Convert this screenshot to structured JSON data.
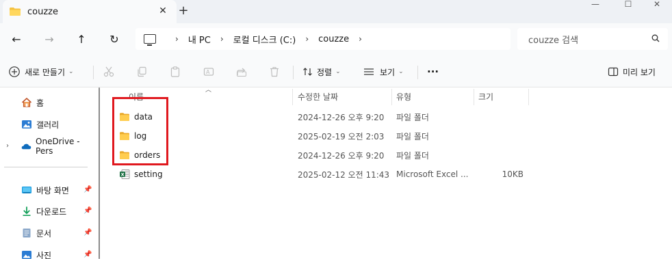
{
  "window": {
    "tab_title": "couzze",
    "tab_close": "✕",
    "new_tab": "+",
    "minimize": "—",
    "maximize": "☐",
    "close": "✕"
  },
  "nav": {
    "back": "←",
    "forward": "→",
    "up": "↑",
    "refresh": "↻"
  },
  "address": {
    "separator": "›",
    "breadcrumbs": [
      "내 PC",
      "로컬 디스크 (C:)",
      "couzze"
    ]
  },
  "search": {
    "placeholder": "couzze 검색"
  },
  "toolbar": {
    "new_label": "새로 만들기",
    "sort_label": "정렬",
    "view_label": "보기",
    "more_label": "···",
    "details_label": "미리 보기"
  },
  "sidebar": {
    "items": [
      {
        "label": "홈",
        "icon": "home-icon"
      },
      {
        "label": "갤러리",
        "icon": "gallery-icon"
      },
      {
        "label": "OneDrive - Pers",
        "icon": "onedrive-icon"
      },
      {
        "label": "바탕 화면",
        "icon": "desktop-icon"
      },
      {
        "label": "다운로드",
        "icon": "download-icon"
      },
      {
        "label": "문서",
        "icon": "documents-icon"
      },
      {
        "label": "사진",
        "icon": "pictures-icon"
      }
    ],
    "expander": "›",
    "pin": "📌"
  },
  "columns": {
    "name": "이름",
    "date": "수정한 날짜",
    "type": "유형",
    "size": "크기"
  },
  "files": [
    {
      "name": "data",
      "date": "2024-12-26 오후 9:20",
      "type": "파일 폴더",
      "size": "",
      "icon": "folder-icon"
    },
    {
      "name": "log",
      "date": "2025-02-19 오전 2:03",
      "type": "파일 폴더",
      "size": "",
      "icon": "folder-icon"
    },
    {
      "name": "orders",
      "date": "2024-12-26 오후 9:20",
      "type": "파일 폴더",
      "size": "",
      "icon": "folder-icon"
    },
    {
      "name": "setting",
      "date": "2025-02-12 오전 11:43",
      "type": "Microsoft Excel ...",
      "size": "10KB",
      "icon": "excel-icon"
    }
  ],
  "colors": {
    "highlight": "#e0181e",
    "folder": "#f5c342",
    "excel": "#1d7044",
    "accent": "#0067c0"
  }
}
